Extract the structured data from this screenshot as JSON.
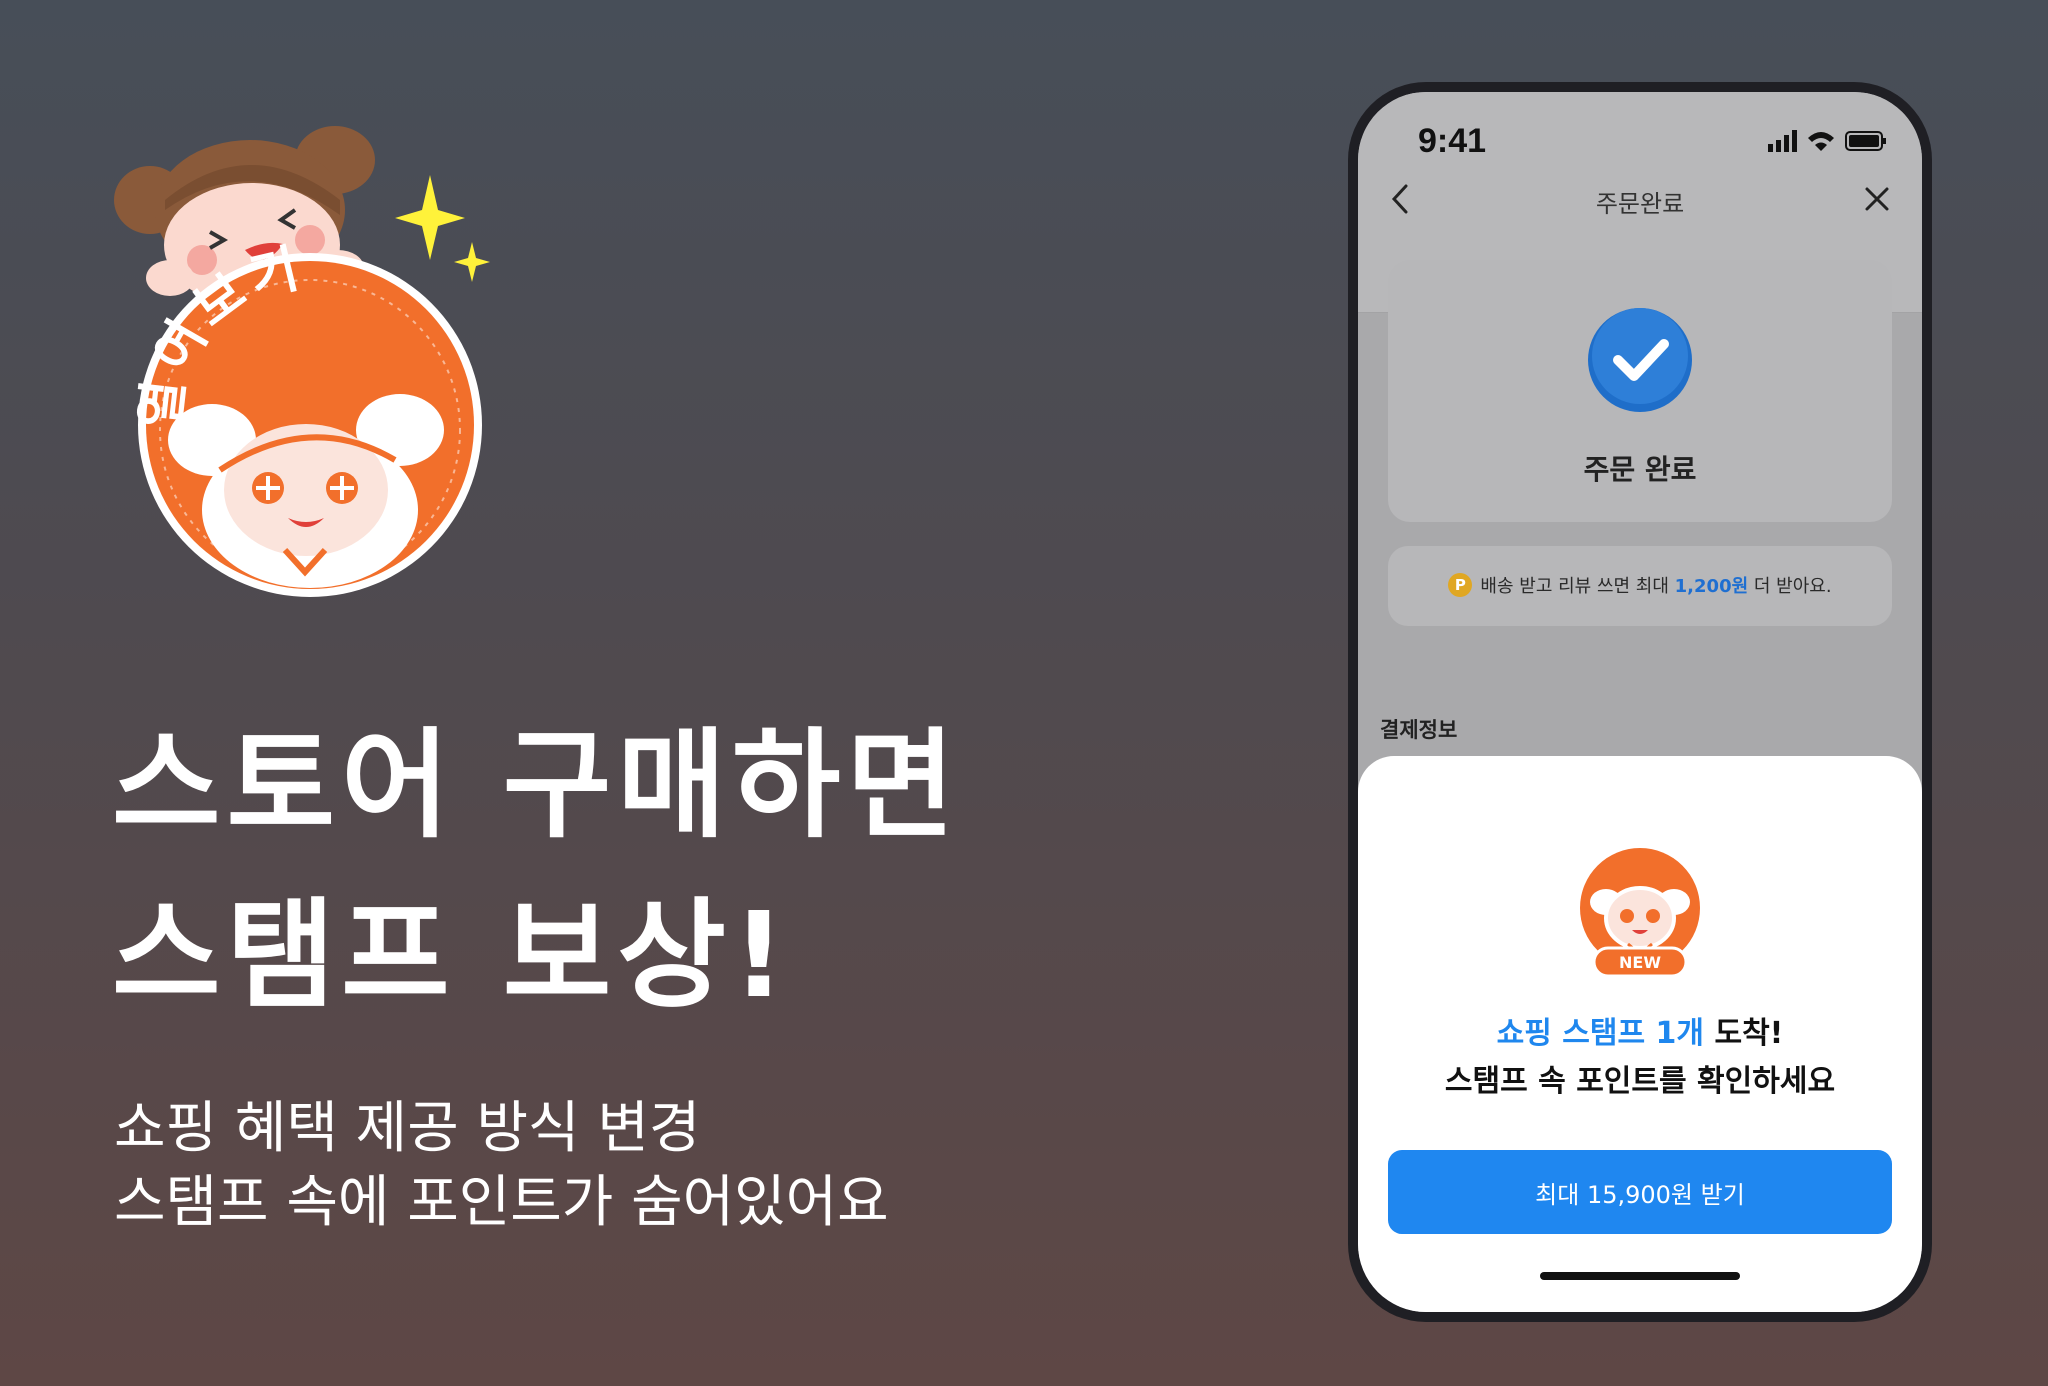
{
  "colors": {
    "accent": "#1f87f0",
    "highlight": "#1f87ee",
    "stamp_orange": "#f26f2b",
    "coin": "#e0a723"
  },
  "sticker": {
    "text": "열어보기",
    "icon": "stamp-mascot-sticker"
  },
  "headline": {
    "line1": "스토어 구매하면",
    "line2": "스탬프 보상!"
  },
  "subline": {
    "line1": "쇼핑 혜택 제공 방식 변경",
    "line2": "스탬프 속에 포인트가 숨어있어요"
  },
  "phone": {
    "status": {
      "time": "9:41",
      "icons": [
        "signal-icon",
        "wifi-icon",
        "battery-icon"
      ]
    },
    "nav": {
      "title": "주문완료",
      "back_icon": "chevron-left-icon",
      "close_icon": "close-icon"
    },
    "order_card": {
      "icon": "check-circle-icon",
      "title": "주문 완료"
    },
    "notice": {
      "coin_label": "P",
      "text": "배송 받고 리뷰 쓰면 최대",
      "amount": "1,200원",
      "suffix": "더 받아요."
    },
    "section_label": "결제정보",
    "sheet": {
      "badge_label": "NEW",
      "highlight": "쇼핑 스탬프 1개",
      "line1_suffix": "도착!",
      "line2": "스탬프 속 포인트를 확인하세요",
      "cta_label": "최대 15,900원 받기"
    }
  }
}
